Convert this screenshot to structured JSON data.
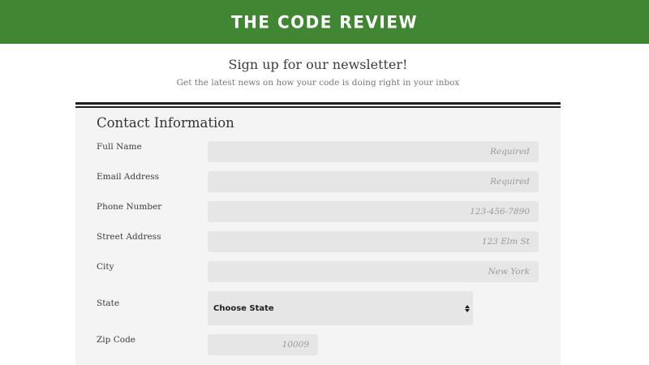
{
  "header": {
    "title": "THE CODE REVIEW",
    "background_color": "#418733"
  },
  "intro": {
    "title": "Sign up for our newsletter!",
    "subtitle": "Get the latest news on how your code is doing right in your inbox"
  },
  "form": {
    "section_title": "Contact Information",
    "fields": {
      "full_name": {
        "label": "Full Name",
        "value": "",
        "placeholder": "Required"
      },
      "email": {
        "label": "Email Address",
        "value": "",
        "placeholder": "Required"
      },
      "phone": {
        "label": "Phone Number",
        "value": "",
        "placeholder": "123-456-7890"
      },
      "street": {
        "label": "Street Address",
        "value": "",
        "placeholder": "123 Elm St"
      },
      "city": {
        "label": "City",
        "value": "",
        "placeholder": "New York"
      },
      "state": {
        "label": "State",
        "selected": "Choose State",
        "arrow_icon": "up-down-chevron-icon"
      },
      "zip": {
        "label": "Zip Code",
        "value": "",
        "placeholder": "10009"
      }
    }
  }
}
